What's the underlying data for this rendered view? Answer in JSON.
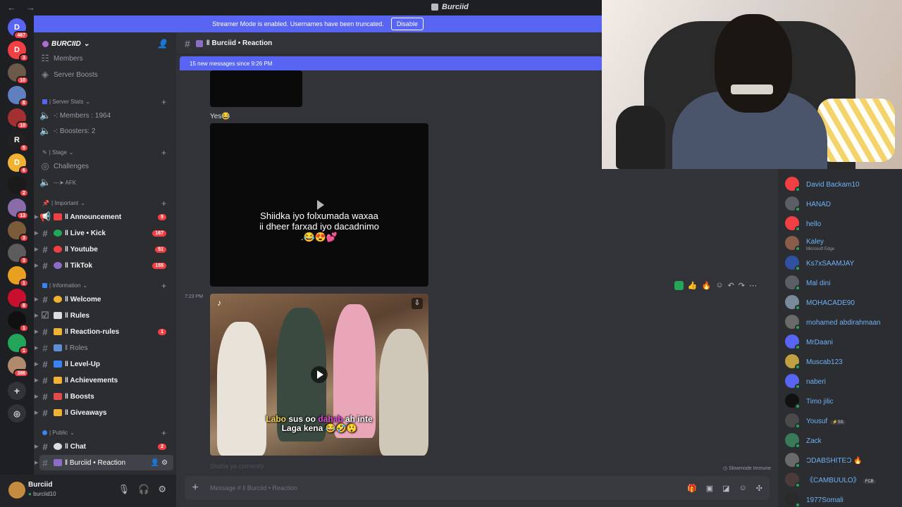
{
  "window": {
    "title": "Burciid"
  },
  "guilds": [
    {
      "name": "discord-home",
      "badge": "467",
      "color": "#5865f2",
      "glyph": "D"
    },
    {
      "name": "server-red",
      "badge": "3",
      "color": "#f23f43",
      "glyph": "D"
    },
    {
      "name": "server-photo-1",
      "badge": "10",
      "color": "#6b5a4a",
      "glyph": ""
    },
    {
      "name": "server-blue",
      "badge": "8",
      "color": "#5f7fbf",
      "glyph": ""
    },
    {
      "name": "server-red-2",
      "badge": "10",
      "color": "#a33030",
      "glyph": ""
    },
    {
      "name": "server-roblox",
      "badge": "5",
      "color": "#222222",
      "glyph": "R"
    },
    {
      "name": "server-orange",
      "badge": "6",
      "color": "#f0b232",
      "glyph": "D"
    },
    {
      "name": "server-dark",
      "badge": "2",
      "color": "#1a1a1a",
      "glyph": ""
    },
    {
      "name": "server-anime",
      "badge": "13",
      "color": "#8a6ca8",
      "glyph": ""
    },
    {
      "name": "server-photo-2",
      "badge": "3",
      "color": "#7a5c3a",
      "glyph": ""
    },
    {
      "name": "server-gray",
      "badge": "3",
      "color": "#5c5c5c",
      "glyph": ""
    },
    {
      "name": "server-gold",
      "badge": "1",
      "color": "#e8a020",
      "glyph": ""
    },
    {
      "name": "server-flag",
      "badge": "8",
      "color": "#c8102e",
      "glyph": ""
    },
    {
      "name": "server-black",
      "badge": "1",
      "color": "#101010",
      "glyph": ""
    },
    {
      "name": "server-green",
      "badge": "1",
      "color": "#23a55a",
      "glyph": ""
    },
    {
      "name": "server-burciid",
      "badge": "386",
      "color": "#b08a6c",
      "glyph": ""
    }
  ],
  "banner": {
    "text": "Streamer Mode is enabled. Usernames have been truncated.",
    "button": "Disable"
  },
  "server": {
    "name": "BURCIID"
  },
  "top_items": [
    "Members",
    "Server Boosts"
  ],
  "categories": {
    "server_stats": "| Server Stats",
    "stage": "| Stage",
    "important": "| Important",
    "information": "| Information",
    "public": "| Public"
  },
  "channels": {
    "members_count": "-: Members : 1964",
    "boosters": "-: Boosters: 2",
    "challenges": "Challenges",
    "afk": "---➤ AFK",
    "announcement": "‖ Announcement",
    "announcement_badge": "5",
    "live_kick": "‖ Live • Kick",
    "live_kick_badge": "167",
    "youtube": "‖ Youtube",
    "youtube_badge": "51",
    "tiktok": "‖ TikTok",
    "tiktok_badge": "155",
    "welcome": "‖ Welcome",
    "rules": "‖ Rules",
    "reaction_rules": "‖ Reaction-rules",
    "reaction_rules_badge": "1",
    "roles": "‖ Roles",
    "level_up": "‖ Level-Up",
    "achievements": "‖ Achievements",
    "boosts": "‖ Boosts",
    "giveaways": "‖ Giveaways",
    "chat": "‖ Chat",
    "chat_badge": "2",
    "burciid_reaction": "‖ Burciid • Reaction"
  },
  "user": {
    "name": "Burciid",
    "status": "burciid10"
  },
  "chat_header": {
    "channel": "‖ Burciid • Reaction"
  },
  "new_messages": "15 new messages since 9:26 PM",
  "messages": {
    "text1": "Yes😂",
    "video1_caption_l1": "Shiidka iyo folxumada waxaa",
    "video1_caption_l2": "ii dheer farxad iyo dacadnimo",
    "video1_caption_l3": ".😂😍💕",
    "timestamp2": "7:23 PM",
    "tiktok_logo": "♪",
    "video2_sub_a": "Labo",
    "video2_sub_b": " sus oo ",
    "video2_sub_c": "dahab",
    "video2_sub_d": " ah inte",
    "video2_sub_e": "Laga kena 😂🤣😲",
    "faded_text": "Shaba ya comently"
  },
  "slowmode": "Slowmode Immune",
  "composer": {
    "placeholder": "Message # ‖ Burciid • Reaction"
  },
  "members": [
    {
      "name": "David Backam10",
      "color": "#f23f43",
      "sub": "",
      "tag": ""
    },
    {
      "name": "HANAD",
      "color": "#5c5e66",
      "sub": "",
      "tag": ""
    },
    {
      "name": "hello",
      "color": "#f23f43",
      "sub": "",
      "tag": ""
    },
    {
      "name": "Kaley",
      "color": "#8a5c4a",
      "sub": "Microsoft Edge",
      "tag": ""
    },
    {
      "name": "Ks7xSAAMJAY",
      "color": "#3050a0",
      "sub": "",
      "tag": ""
    },
    {
      "name": "Mal dini",
      "color": "#5c5e66",
      "sub": "",
      "tag": ""
    },
    {
      "name": "MOHACADE90",
      "color": "#7a8a9a",
      "sub": "",
      "tag": ""
    },
    {
      "name": "mohamed abdirahmaan",
      "color": "#6a6a6a",
      "sub": "",
      "tag": ""
    },
    {
      "name": "MrDaani",
      "color": "#5865f2",
      "sub": "",
      "tag": ""
    },
    {
      "name": "Muscab123",
      "color": "#c0a040",
      "sub": "",
      "tag": ""
    },
    {
      "name": "naberi",
      "color": "#5865f2",
      "sub": "",
      "tag": ""
    },
    {
      "name": "Timo jilic",
      "color": "#111111",
      "sub": "",
      "tag": ""
    },
    {
      "name": "Yousuf",
      "color": "#4a4a4a",
      "sub": "",
      "tag": "⚡SS"
    },
    {
      "name": "Zack",
      "color": "#3a7a5a",
      "sub": "",
      "tag": ""
    },
    {
      "name": "ƆDABSHITEƆ 🔥",
      "color": "#6a6a6a",
      "sub": "",
      "tag": ""
    },
    {
      "name": "《CAMBUULO》",
      "color": "#4a3a3a",
      "sub": "",
      "tag": "FCB"
    },
    {
      "name": "1977Somali",
      "color": "#2a2a2a",
      "sub": "",
      "tag": ""
    }
  ]
}
